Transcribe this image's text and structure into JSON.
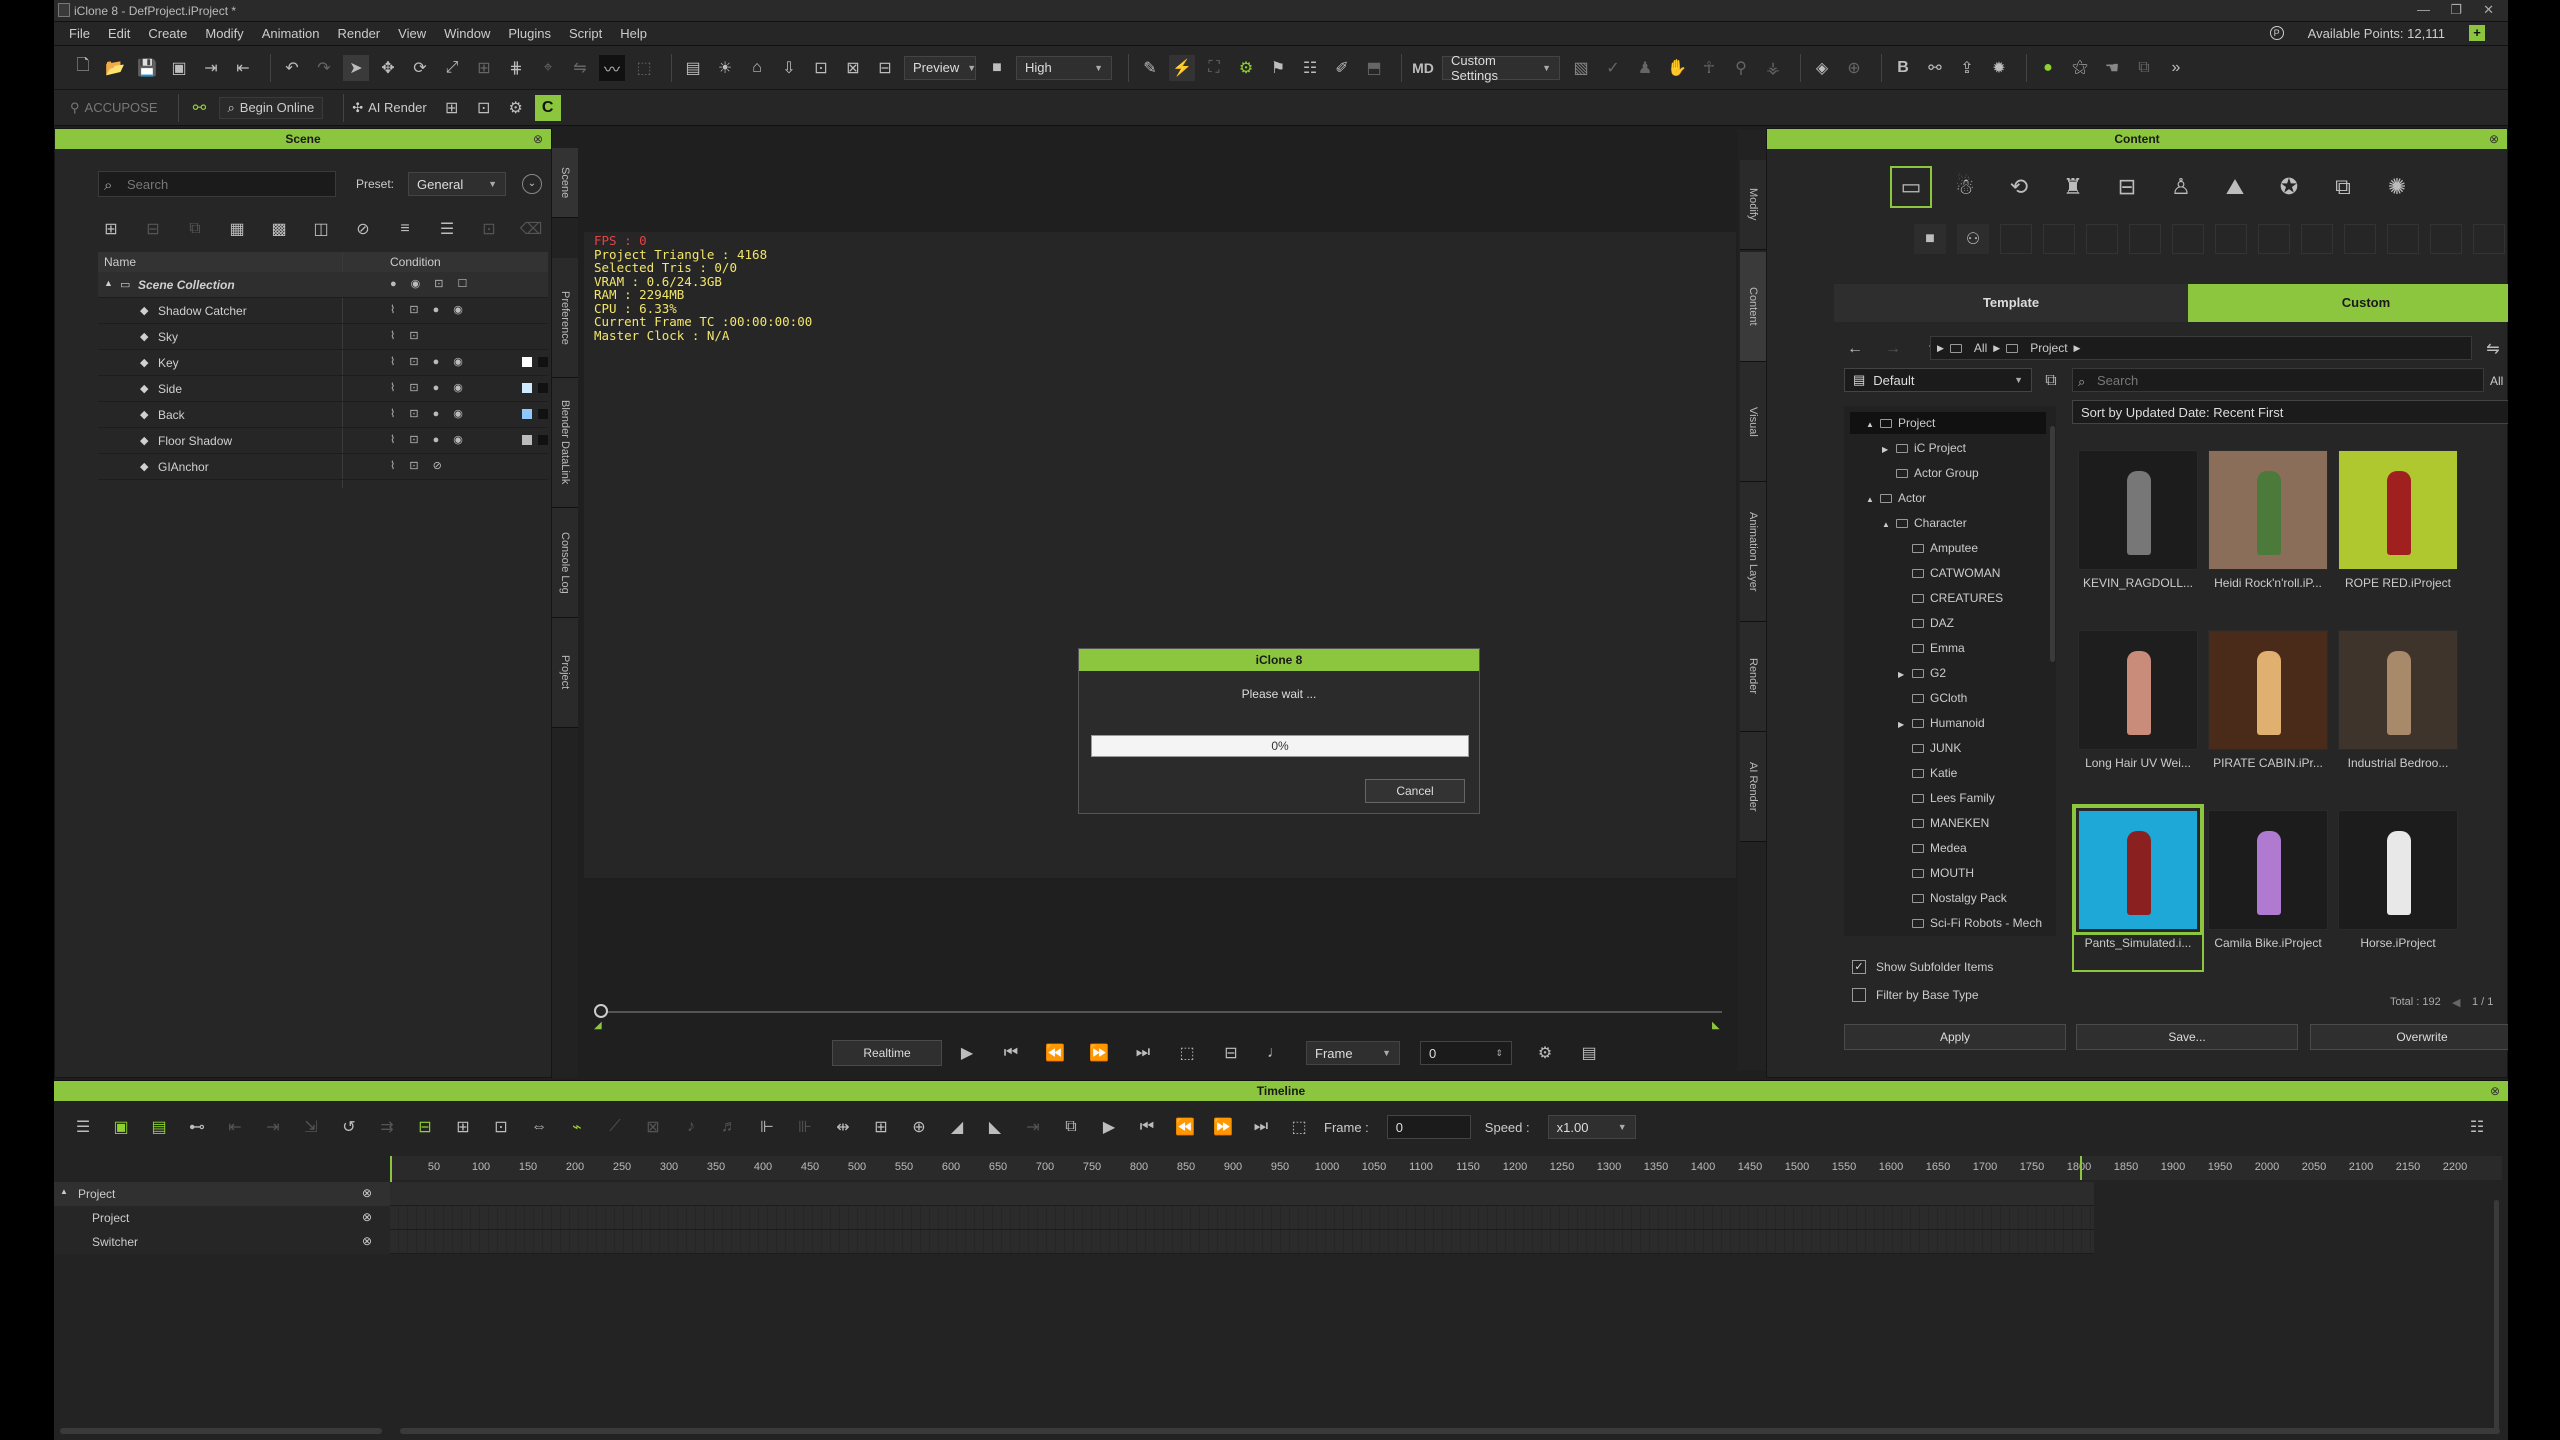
{
  "window": {
    "title": "iClone 8 - DefProject.iProject *"
  },
  "menu": [
    "File",
    "Edit",
    "Create",
    "Modify",
    "Animation",
    "Render",
    "View",
    "Window",
    "Plugins",
    "Script",
    "Help"
  ],
  "account": {
    "points_label": "Available Points: 12,111"
  },
  "toolbar": {
    "preview_label": "Preview",
    "quality_label": "High",
    "custom_settings_label": "Custom Settings",
    "accupose_label": "ACCUPOSE",
    "begin_online_label": "Begin Online",
    "ai_render_label": "AI Render"
  },
  "scene": {
    "title": "Scene",
    "search_placeholder": "Search",
    "preset_label": "Preset:",
    "preset_value": "General",
    "col_name": "Name",
    "col_condition": "Condition",
    "items": [
      {
        "label": "Scene Collection",
        "indent": 0
      },
      {
        "label": "Shadow Catcher",
        "indent": 2
      },
      {
        "label": "Sky",
        "indent": 2
      },
      {
        "label": "Key",
        "indent": 2
      },
      {
        "label": "Side",
        "indent": 2
      },
      {
        "label": "Back",
        "indent": 2
      },
      {
        "label": "Floor Shadow",
        "indent": 2
      },
      {
        "label": "GIAnchor",
        "indent": 2
      }
    ]
  },
  "left_tabs": [
    "Scene",
    "Preference",
    "Blender DataLink",
    "Console Log",
    "Project"
  ],
  "right_tabs": [
    "Modify",
    "Content",
    "Visual",
    "Animation Layer",
    "Render",
    "AI Render"
  ],
  "stats": {
    "fps": "FPS : 0",
    "triangles": "Project Triangle : 4168",
    "selected": "Selected Tris : 0/0",
    "vram": "VRAM : 0.6/24.3GB",
    "ram": "RAM : 2294MB",
    "cpu": "CPU : 6.33%",
    "frame_tc": "Current Frame TC :00:00:00:00",
    "master_clock": "Master Clock : N/A"
  },
  "dialog": {
    "title": "iClone 8",
    "message": "Please wait ...",
    "progress_text": "0%",
    "progress": 0,
    "cancel_label": "Cancel"
  },
  "viewport_controls": {
    "realtime_label": "Realtime",
    "frame_label": "Frame",
    "frame_value": "0"
  },
  "content": {
    "title": "Content",
    "tab_template": "Template",
    "tab_custom": "Custom",
    "path_all": "All",
    "path_project": "Project",
    "filter_value": "Default",
    "search_placeholder": "Search",
    "all_label": "All",
    "sort_label": "Sort by Updated Date: Recent First",
    "tree": [
      {
        "label": "Project",
        "indent": 0,
        "arrow": "▲",
        "selected": true
      },
      {
        "label": "iC Project",
        "indent": 1,
        "arrow": "▶"
      },
      {
        "label": "Actor Group",
        "indent": 1,
        "arrow": ""
      },
      {
        "label": "Actor",
        "indent": 0,
        "arrow": "▲"
      },
      {
        "label": "Character",
        "indent": 1,
        "arrow": "▲"
      },
      {
        "label": "Amputee",
        "indent": 2,
        "arrow": ""
      },
      {
        "label": "CATWOMAN",
        "indent": 2,
        "arrow": ""
      },
      {
        "label": "CREATURES",
        "indent": 2,
        "arrow": ""
      },
      {
        "label": "DAZ",
        "indent": 2,
        "arrow": ""
      },
      {
        "label": "Emma",
        "indent": 2,
        "arrow": ""
      },
      {
        "label": "G2",
        "indent": 2,
        "arrow": "▶"
      },
      {
        "label": "GCloth",
        "indent": 2,
        "arrow": ""
      },
      {
        "label": "Humanoid",
        "indent": 2,
        "arrow": "▶"
      },
      {
        "label": "JUNK",
        "indent": 2,
        "arrow": ""
      },
      {
        "label": "Katie",
        "indent": 2,
        "arrow": ""
      },
      {
        "label": "Lees Family",
        "indent": 2,
        "arrow": ""
      },
      {
        "label": "MANEKEN",
        "indent": 2,
        "arrow": ""
      },
      {
        "label": "Medea",
        "indent": 2,
        "arrow": ""
      },
      {
        "label": "MOUTH",
        "indent": 2,
        "arrow": ""
      },
      {
        "label": "Nostalgy Pack",
        "indent": 2,
        "arrow": ""
      },
      {
        "label": "Sci-Fi Robots - Mech",
        "indent": 2,
        "arrow": ""
      }
    ],
    "thumbnails": [
      {
        "label": "KEVIN_RAGDOLL...",
        "bg": "#1c1c1c",
        "fg": "#777"
      },
      {
        "label": "Heidi Rock'n'roll.iP...",
        "bg": "#8a6e5a",
        "fg": "#4c7a3a"
      },
      {
        "label": "ROPE RED.iProject",
        "bg": "#b0c830",
        "fg": "#a02020"
      },
      {
        "label": "Long Hair UV Wei...",
        "bg": "#1e1e1e",
        "fg": "#c98c7a"
      },
      {
        "label": "PIRATE CABIN.iPr...",
        "bg": "#4a2a18",
        "fg": "#e0b070"
      },
      {
        "label": "Industrial Bedroo...",
        "bg": "#3e342c",
        "fg": "#a88a6a"
      },
      {
        "label": "Pants_Simulated.i...",
        "bg": "#1ea8d8",
        "fg": "#8a2020",
        "selected": true
      },
      {
        "label": "Camila Bike.iProject",
        "bg": "#1c1c1c",
        "fg": "#b07ad0"
      },
      {
        "label": "Horse.iProject",
        "bg": "#1c1c1c",
        "fg": "#e8e8e8"
      }
    ],
    "show_subfolder_label": "Show Subfolder Items",
    "show_subfolder_checked": true,
    "filter_base_label": "Filter by Base Type",
    "filter_base_checked": false,
    "total_label": "Total : 192",
    "page_label": "1 / 1",
    "apply_label": "Apply",
    "save_label": "Save...",
    "overwrite_label": "Overwrite"
  },
  "timeline": {
    "title": "Timeline",
    "frame_label": "Frame :",
    "frame_value": "0",
    "speed_label": "Speed :",
    "speed_value": "x1.00",
    "ruler_ticks": [
      "50",
      "100",
      "150",
      "200",
      "250",
      "300",
      "350",
      "400",
      "450",
      "500",
      "550",
      "600",
      "650",
      "700",
      "750",
      "800",
      "850",
      "900",
      "950",
      "1000",
      "1050",
      "1100",
      "1150",
      "1200",
      "1250",
      "1300",
      "1350",
      "1400",
      "1450",
      "1500",
      "1550",
      "1600",
      "1650",
      "1700",
      "1750",
      "1800",
      "1850",
      "1900",
      "1950",
      "2000",
      "2050",
      "2100",
      "2150",
      "2200"
    ],
    "tracks": [
      {
        "label": "Project",
        "group": true
      },
      {
        "label": "Project",
        "group": false
      },
      {
        "label": "Switcher",
        "group": false
      }
    ]
  },
  "colors": {
    "accent": "#8cc63f",
    "stats_text": "#f2e66b",
    "fps_text": "#e04545"
  }
}
